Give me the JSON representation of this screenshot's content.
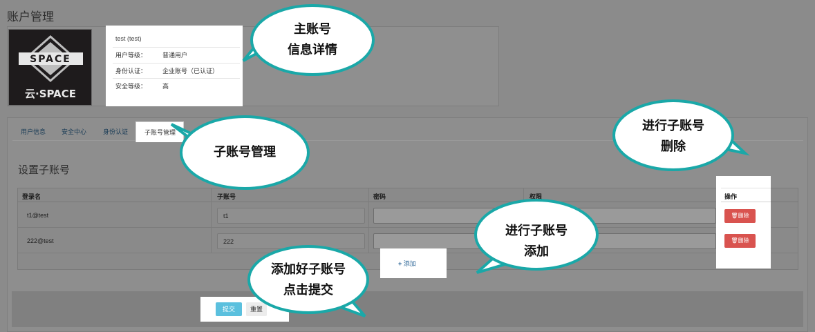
{
  "page": {
    "title": "账户管理"
  },
  "logo": {
    "badge_text": "SPACE",
    "caption": "云·SPACE"
  },
  "user_info": {
    "header": "test (test)",
    "rows": [
      {
        "label": "用户等级：",
        "value": "普通用户"
      },
      {
        "label": "身份认证：",
        "value": "企业账号（已认证）"
      },
      {
        "label": "安全等级：",
        "value": "高"
      }
    ]
  },
  "tabs": [
    {
      "label": "用户信息"
    },
    {
      "label": "安全中心"
    },
    {
      "label": "身份认证"
    },
    {
      "label": "子账号管理",
      "active": true
    }
  ],
  "section": {
    "title": "设置子账号"
  },
  "table": {
    "headers": [
      "登录名",
      "子账号",
      "密码",
      "权限",
      "操作"
    ],
    "rows": [
      {
        "login": "t1@test",
        "sub_account": "t1",
        "password": "",
        "permission": "",
        "action": "删除"
      },
      {
        "login": "222@test",
        "sub_account": "222",
        "password": "",
        "permission": "",
        "action": "删除"
      }
    ],
    "add_label": "添加"
  },
  "footer": {
    "submit_label": "提交",
    "reset_label": "重置"
  },
  "callouts": {
    "main_account": [
      "主账号",
      "信息详情"
    ],
    "sub_manage": [
      "子账号管理"
    ],
    "delete": [
      "进行子账号",
      "删除"
    ],
    "add": [
      "进行子账号",
      "添加"
    ],
    "submit": [
      "添加好子账号",
      "点击提交"
    ]
  },
  "colors": {
    "callout_border": "#1aa8a8",
    "delete_button": "#d9534f",
    "submit_button": "#5bc0de"
  }
}
